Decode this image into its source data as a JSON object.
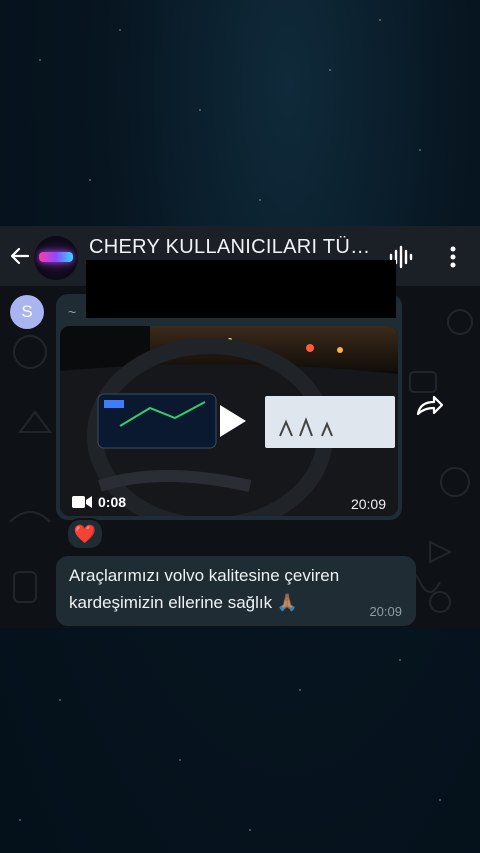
{
  "chat": {
    "title": "CHERY KULLANICILARI TÜR...",
    "back_icon": "arrow-left-icon",
    "voice_icon": "voice-chat-icon",
    "more_icon": "more-vert-icon"
  },
  "messages": [
    {
      "type": "video",
      "sender_initial": "S",
      "sender_prefix": "~",
      "duration": "0:08",
      "time": "20:09",
      "reaction": "❤️"
    },
    {
      "type": "text",
      "text": "Araçlarımızı volvo kalitesine çeviren kardeşimizin ellerine sağlık 🙏🏽",
      "time": "20:09"
    }
  ],
  "colors": {
    "topbar": "#1b2027",
    "bubble": "#1f2c34",
    "chat_bg": "#0e1216",
    "avatar": "#aab4f0"
  }
}
